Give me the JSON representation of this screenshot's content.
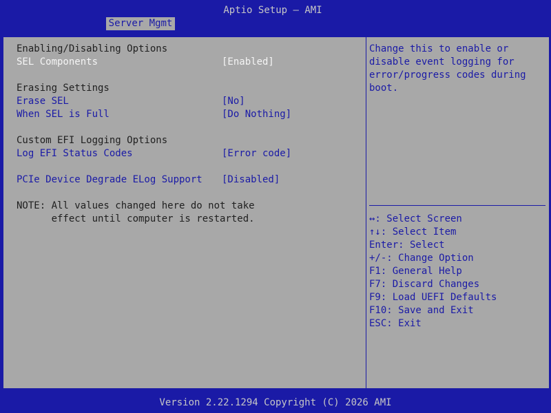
{
  "header": {
    "title": "Aptio Setup – AMI",
    "active_tab": "Server Mgmt"
  },
  "main": {
    "sections": {
      "enabling": {
        "heading": "Enabling/Disabling Options",
        "sel_components": {
          "label": "SEL Components",
          "value": "[Enabled]"
        }
      },
      "erasing": {
        "heading": "Erasing Settings",
        "erase_sel": {
          "label": "Erase SEL",
          "value": "[No]"
        },
        "when_full": {
          "label": "When SEL is Full",
          "value": "[Do Nothing]"
        }
      },
      "custom_efi": {
        "heading": "Custom EFI Logging Options",
        "log_efi": {
          "label": "Log EFI Status Codes",
          "value": "[Error code]"
        }
      },
      "pcie": {
        "label": "PCIe Device Degrade ELog Support",
        "value": "[Disabled]"
      }
    },
    "note_line1": "NOTE: All values changed here do not take",
    "note_line2": "      effect until computer is restarted."
  },
  "help": {
    "text": "Change this to enable or disable event logging for error/progress codes during boot."
  },
  "keys": [
    "↔: Select Screen",
    "↑↓: Select Item",
    "Enter: Select",
    "+/-: Change Option",
    "F1: General Help",
    "F7: Discard Changes",
    "F9: Load UEFI Defaults",
    "F10: Save and Exit",
    "ESC: Exit"
  ],
  "footer": {
    "version": "Version 2.22.1294 Copyright (C) 2026 AMI"
  },
  "colors": {
    "bios_blue": "#1a1aa6",
    "panel_gray": "#a8a8a8",
    "selected_value_white": "#f5f5f5"
  }
}
